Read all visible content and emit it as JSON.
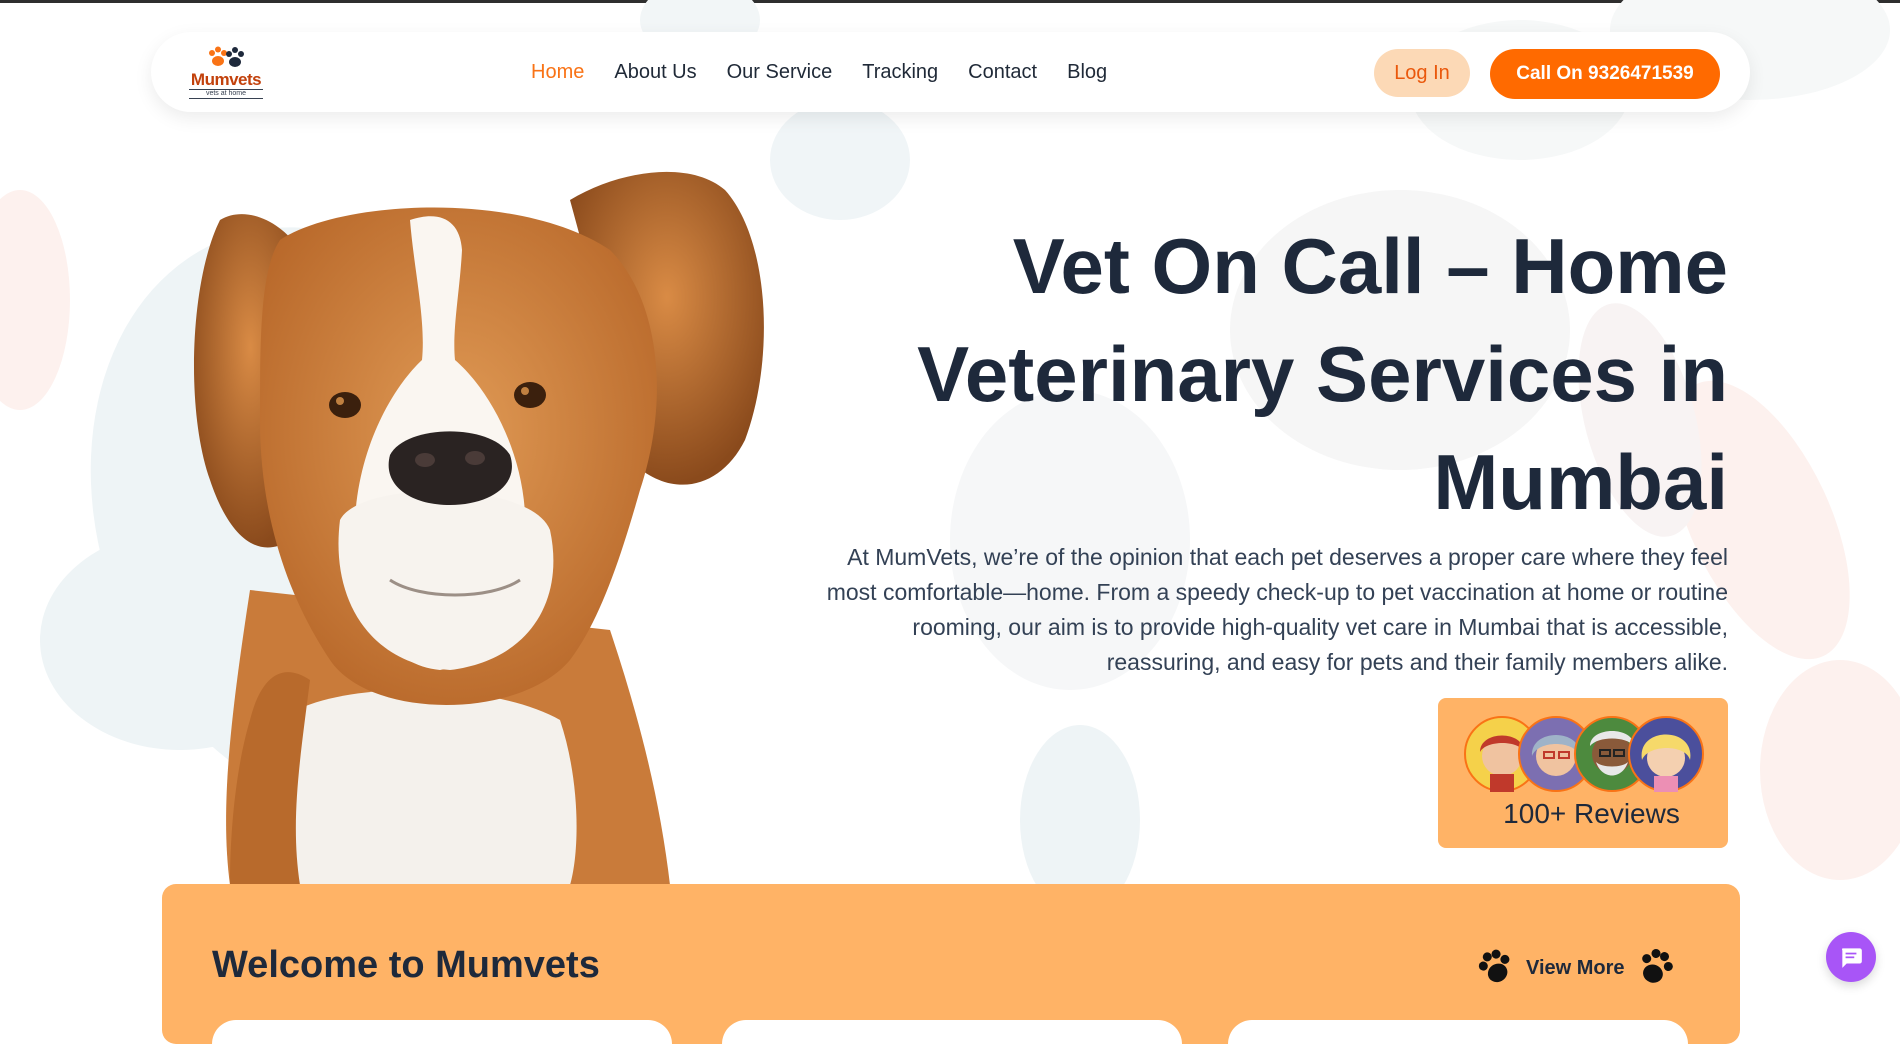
{
  "brand": {
    "logo_text": "Mumvets",
    "logo_sub": "vets at home"
  },
  "nav": {
    "items": [
      {
        "label": "Home",
        "active": true
      },
      {
        "label": "About Us",
        "active": false
      },
      {
        "label": "Our Service",
        "active": false
      },
      {
        "label": "Tracking",
        "active": false
      },
      {
        "label": "Contact",
        "active": false
      },
      {
        "label": "Blog",
        "active": false
      }
    ],
    "login_label": "Log In",
    "call_label": "Call On 9326471539"
  },
  "hero": {
    "title": "Vet On Call – Home Veterinary Services in Mumbai",
    "description": "At MumVets, we’re of the opinion that each pet deserves a proper care where they feel most comfortable—home. From a speedy check-up to pet vaccination at home or routine rooming, our aim is to provide high-quality vet care in Mumbai that is accessible, reassuring, and easy for pets and their family members alike.",
    "image_icon": "beagle-dog-photo"
  },
  "reviews": {
    "label": "100+ Reviews",
    "avatar_icons": [
      "avatar-red-hair-woman",
      "avatar-gray-hair-woman",
      "avatar-bearded-man",
      "avatar-blonde-woman"
    ]
  },
  "welcome": {
    "title": "Welcome to Mumvets",
    "view_more_label": "View More"
  },
  "chat": {
    "icon": "chat-icon"
  },
  "colors": {
    "accent": "#ff6a00",
    "accent_text": "#f97316",
    "login_bg": "#fcd9b6",
    "section_bg": "#ffb366",
    "title_text": "#1e293b",
    "chat_bg": "#a855f7"
  }
}
